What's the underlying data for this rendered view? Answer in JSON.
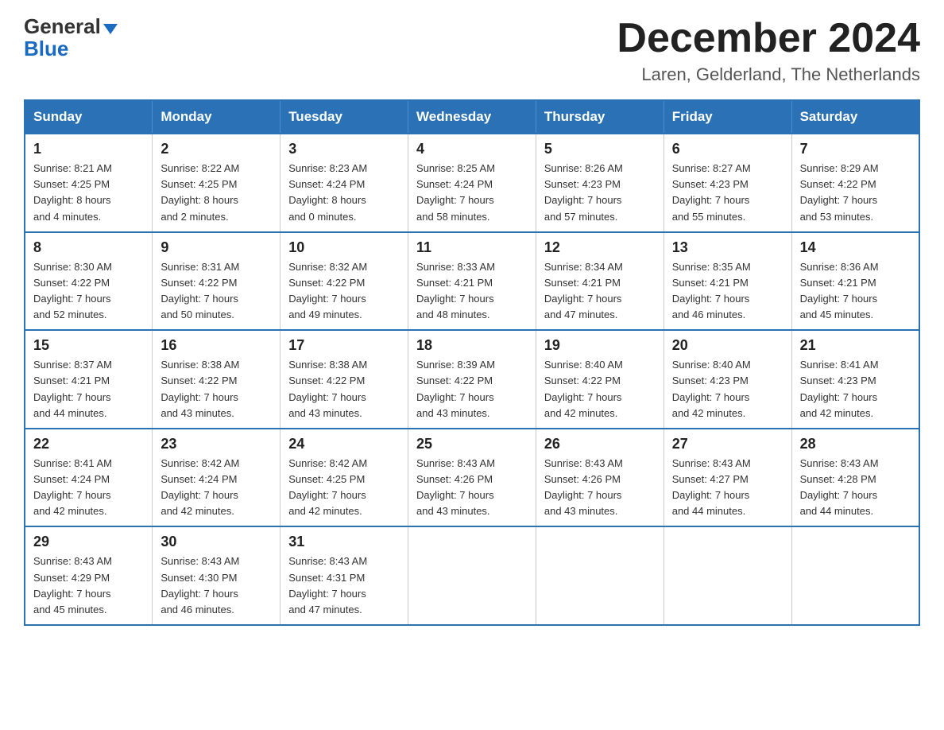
{
  "header": {
    "logo_general": "General",
    "logo_blue": "Blue",
    "title": "December 2024",
    "subtitle": "Laren, Gelderland, The Netherlands"
  },
  "days_of_week": [
    "Sunday",
    "Monday",
    "Tuesday",
    "Wednesday",
    "Thursday",
    "Friday",
    "Saturday"
  ],
  "weeks": [
    [
      {
        "day": "1",
        "sunrise": "8:21 AM",
        "sunset": "4:25 PM",
        "daylight": "8 hours and 4 minutes."
      },
      {
        "day": "2",
        "sunrise": "8:22 AM",
        "sunset": "4:25 PM",
        "daylight": "8 hours and 2 minutes."
      },
      {
        "day": "3",
        "sunrise": "8:23 AM",
        "sunset": "4:24 PM",
        "daylight": "8 hours and 0 minutes."
      },
      {
        "day": "4",
        "sunrise": "8:25 AM",
        "sunset": "4:24 PM",
        "daylight": "7 hours and 58 minutes."
      },
      {
        "day": "5",
        "sunrise": "8:26 AM",
        "sunset": "4:23 PM",
        "daylight": "7 hours and 57 minutes."
      },
      {
        "day": "6",
        "sunrise": "8:27 AM",
        "sunset": "4:23 PM",
        "daylight": "7 hours and 55 minutes."
      },
      {
        "day": "7",
        "sunrise": "8:29 AM",
        "sunset": "4:22 PM",
        "daylight": "7 hours and 53 minutes."
      }
    ],
    [
      {
        "day": "8",
        "sunrise": "8:30 AM",
        "sunset": "4:22 PM",
        "daylight": "7 hours and 52 minutes."
      },
      {
        "day": "9",
        "sunrise": "8:31 AM",
        "sunset": "4:22 PM",
        "daylight": "7 hours and 50 minutes."
      },
      {
        "day": "10",
        "sunrise": "8:32 AM",
        "sunset": "4:22 PM",
        "daylight": "7 hours and 49 minutes."
      },
      {
        "day": "11",
        "sunrise": "8:33 AM",
        "sunset": "4:21 PM",
        "daylight": "7 hours and 48 minutes."
      },
      {
        "day": "12",
        "sunrise": "8:34 AM",
        "sunset": "4:21 PM",
        "daylight": "7 hours and 47 minutes."
      },
      {
        "day": "13",
        "sunrise": "8:35 AM",
        "sunset": "4:21 PM",
        "daylight": "7 hours and 46 minutes."
      },
      {
        "day": "14",
        "sunrise": "8:36 AM",
        "sunset": "4:21 PM",
        "daylight": "7 hours and 45 minutes."
      }
    ],
    [
      {
        "day": "15",
        "sunrise": "8:37 AM",
        "sunset": "4:21 PM",
        "daylight": "7 hours and 44 minutes."
      },
      {
        "day": "16",
        "sunrise": "8:38 AM",
        "sunset": "4:22 PM",
        "daylight": "7 hours and 43 minutes."
      },
      {
        "day": "17",
        "sunrise": "8:38 AM",
        "sunset": "4:22 PM",
        "daylight": "7 hours and 43 minutes."
      },
      {
        "day": "18",
        "sunrise": "8:39 AM",
        "sunset": "4:22 PM",
        "daylight": "7 hours and 43 minutes."
      },
      {
        "day": "19",
        "sunrise": "8:40 AM",
        "sunset": "4:22 PM",
        "daylight": "7 hours and 42 minutes."
      },
      {
        "day": "20",
        "sunrise": "8:40 AM",
        "sunset": "4:23 PM",
        "daylight": "7 hours and 42 minutes."
      },
      {
        "day": "21",
        "sunrise": "8:41 AM",
        "sunset": "4:23 PM",
        "daylight": "7 hours and 42 minutes."
      }
    ],
    [
      {
        "day": "22",
        "sunrise": "8:41 AM",
        "sunset": "4:24 PM",
        "daylight": "7 hours and 42 minutes."
      },
      {
        "day": "23",
        "sunrise": "8:42 AM",
        "sunset": "4:24 PM",
        "daylight": "7 hours and 42 minutes."
      },
      {
        "day": "24",
        "sunrise": "8:42 AM",
        "sunset": "4:25 PM",
        "daylight": "7 hours and 42 minutes."
      },
      {
        "day": "25",
        "sunrise": "8:43 AM",
        "sunset": "4:26 PM",
        "daylight": "7 hours and 43 minutes."
      },
      {
        "day": "26",
        "sunrise": "8:43 AM",
        "sunset": "4:26 PM",
        "daylight": "7 hours and 43 minutes."
      },
      {
        "day": "27",
        "sunrise": "8:43 AM",
        "sunset": "4:27 PM",
        "daylight": "7 hours and 44 minutes."
      },
      {
        "day": "28",
        "sunrise": "8:43 AM",
        "sunset": "4:28 PM",
        "daylight": "7 hours and 44 minutes."
      }
    ],
    [
      {
        "day": "29",
        "sunrise": "8:43 AM",
        "sunset": "4:29 PM",
        "daylight": "7 hours and 45 minutes."
      },
      {
        "day": "30",
        "sunrise": "8:43 AM",
        "sunset": "4:30 PM",
        "daylight": "7 hours and 46 minutes."
      },
      {
        "day": "31",
        "sunrise": "8:43 AM",
        "sunset": "4:31 PM",
        "daylight": "7 hours and 47 minutes."
      },
      null,
      null,
      null,
      null
    ]
  ],
  "labels": {
    "sunrise": "Sunrise:",
    "sunset": "Sunset:",
    "daylight": "Daylight:"
  }
}
